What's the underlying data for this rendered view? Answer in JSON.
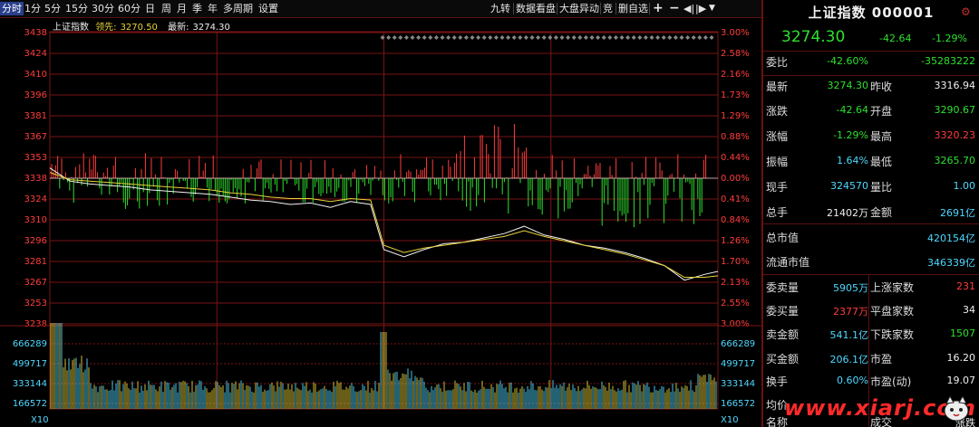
{
  "toolbar": {
    "left_items": [
      {
        "label": "分时",
        "active": true
      },
      {
        "label": "1分"
      },
      {
        "label": "5分"
      },
      {
        "label": "15分"
      },
      {
        "label": "30分"
      },
      {
        "label": "60分"
      },
      {
        "label": "日"
      },
      {
        "label": "周"
      },
      {
        "label": "月"
      },
      {
        "label": "季"
      },
      {
        "label": "年"
      },
      {
        "label": "多周期"
      },
      {
        "label": "设置"
      }
    ],
    "right_items": [
      {
        "label": "九转"
      },
      {
        "label": "数据看盘"
      },
      {
        "label": "大盘异动"
      },
      {
        "label": "竞"
      },
      {
        "label": "删自选"
      }
    ],
    "icons": [
      "plus-icon",
      "minus-icon",
      "skip-left-icon",
      "skip-right-icon",
      "dropdown-icon"
    ]
  },
  "legend": {
    "name": "上证指数",
    "leader_label": "领先:",
    "leader_value": "3270.50",
    "latest_label": "最新:",
    "latest_value": "3274.30"
  },
  "colors": {
    "up": "#ff3c3c",
    "down": "#2ee02e",
    "grid": "#7a1414",
    "price_line": "#f2f2f2",
    "avg_line": "#e8d23a",
    "axis_text": "#ff3c3c",
    "cyan": "#4fd8ff"
  },
  "chart_data": {
    "type": "line",
    "price_axis": {
      "ticks": [
        3438,
        3424,
        3410,
        3396,
        3381,
        3367,
        3353,
        3338,
        3324,
        3310,
        3296,
        3281,
        3267,
        3253,
        3238
      ],
      "pct_ticks": [
        "3.00%",
        "2.58%",
        "2.16%",
        "1.73%",
        "1.29%",
        "0.88%",
        "0.44%",
        "0.00%",
        "0.41%",
        "0.84%",
        "1.26%",
        "1.70%",
        "2.13%",
        "2.55%",
        "3.00%"
      ],
      "prev_close": 3338,
      "ylim": [
        3238,
        3438
      ]
    },
    "volume_axis": {
      "ticks": [
        666289,
        499717,
        333144,
        166572
      ],
      "unit": "X10"
    },
    "x": [
      0,
      0.03,
      0.06,
      0.09,
      0.12,
      0.15,
      0.18,
      0.21,
      0.24,
      0.27,
      0.3,
      0.33,
      0.36,
      0.39,
      0.42,
      0.45,
      0.48,
      0.5,
      0.53,
      0.56,
      0.59,
      0.62,
      0.65,
      0.68,
      0.71,
      0.74,
      0.77,
      0.8,
      0.83,
      0.86,
      0.89,
      0.92,
      0.95,
      0.98,
      1.0
    ],
    "series": [
      {
        "values": [
          3345,
          3336,
          3334,
          3333,
          3332,
          3330,
          3329,
          3328,
          3327,
          3325,
          3323,
          3322,
          3320,
          3321,
          3318,
          3322,
          3320,
          3289,
          3284,
          3289,
          3293,
          3294,
          3297,
          3300,
          3305,
          3299,
          3296,
          3292,
          3290,
          3287,
          3283,
          3278,
          3268,
          3272,
          3274
        ]
      },
      {
        "values": [
          3342,
          3337,
          3336,
          3335,
          3334,
          3333,
          3332,
          3331,
          3330,
          3328,
          3327,
          3325,
          3324,
          3324,
          3322,
          3324,
          3323,
          3292,
          3287,
          3290,
          3292,
          3294,
          3296,
          3298,
          3302,
          3298,
          3295,
          3292,
          3289,
          3286,
          3282,
          3278,
          3270,
          3270,
          3271
        ]
      }
    ]
  },
  "panel": {
    "title": "上证指数 000001",
    "price": "3274.30",
    "change": "-42.64",
    "change_pct": "-1.29%",
    "rows": [
      {
        "l": "委比",
        "v1": "-42.60%",
        "c1": "green",
        "v2": "-35283222",
        "c2": "green"
      },
      {
        "l": "最新",
        "v1": "3274.30",
        "c1": "green",
        "l2": "昨收",
        "v2": "3316.94",
        "c2": "white"
      },
      {
        "l": "涨跌",
        "v1": "-42.64",
        "c1": "green",
        "l2": "开盘",
        "v2": "3290.67",
        "c2": "green"
      },
      {
        "l": "涨幅",
        "v1": "-1.29%",
        "c1": "green",
        "l2": "最高",
        "v2": "3320.23",
        "c2": "red"
      },
      {
        "l": "振幅",
        "v1": "1.64%",
        "c1": "cyan",
        "l2": "最低",
        "v2": "3265.70",
        "c2": "green"
      },
      {
        "l": "现手",
        "v1": "324570",
        "c1": "cyan",
        "l2": "量比",
        "v2": "1.00",
        "c2": "cyan"
      },
      {
        "l": "总手",
        "v1": "21402万",
        "c1": "white",
        "l2": "金额",
        "v2": "2691亿",
        "c2": "cyan"
      },
      {
        "l": "总市值",
        "v2": "420154亿",
        "c2": "cyan"
      },
      {
        "l": "流通市值",
        "v2": "346339亿",
        "c2": "cyan"
      },
      {
        "l": "委卖量",
        "v1": "5905万",
        "c1": "cyan",
        "l2": "上涨家数",
        "v2": "231",
        "c2": "red"
      },
      {
        "l": "委买量",
        "v1": "2377万",
        "c1": "red",
        "l2": "平盘家数",
        "v2": "34",
        "c2": "white"
      },
      {
        "l": "卖金额",
        "v1": "541.1亿",
        "c1": "cyan",
        "l2": "下跌家数",
        "v2": "1507",
        "c2": "green"
      },
      {
        "l": "买金额",
        "v1": "206.1亿",
        "c1": "cyan",
        "l2": "市盈",
        "v2": "16.20",
        "c2": "white"
      },
      {
        "l": "换手",
        "v1": "0.60%",
        "c1": "cyan",
        "l2": "市盈(动)",
        "v2": "19.07",
        "c2": "white"
      },
      {
        "l": "均价",
        "v1": "",
        "c1": "white",
        "l2": "",
        "v2": "",
        "c2": "white"
      },
      {
        "l": "名称",
        "l2": "成交",
        "v2": "涨跌",
        "c2": "white"
      }
    ]
  },
  "watermark": {
    "text": "www.xiarj.com"
  }
}
